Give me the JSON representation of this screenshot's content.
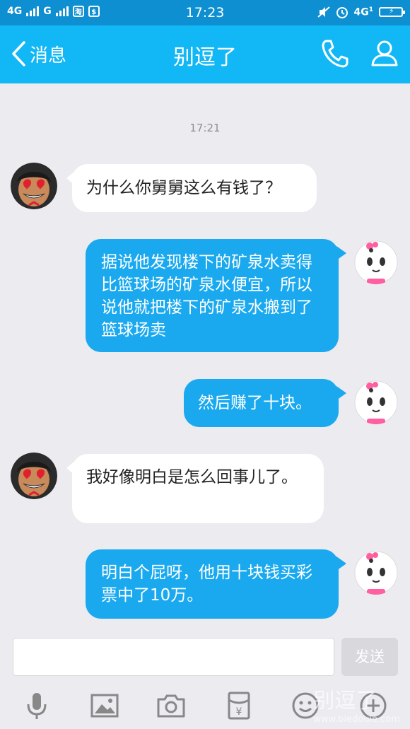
{
  "status_bar": {
    "network_1": "4G",
    "network_2": "G",
    "app_icon_1": "淘",
    "app_icon_2": "$",
    "time": "17:23",
    "network_right": "4G",
    "network_right_sub": "1",
    "battery_glyph": "⚡"
  },
  "nav": {
    "back_label": "消息",
    "title": "别逗了",
    "icons": [
      "phone-icon",
      "profile-icon"
    ]
  },
  "chat": {
    "timestamp": "17:21",
    "messages": [
      {
        "direction": "in",
        "text": "为什么你舅舅这么有钱了？"
      },
      {
        "direction": "out",
        "text": "据说他发现楼下的矿泉水卖得比篮球场的矿泉水便宜，所以说他就把楼下的矿泉水搬到了篮球场卖"
      },
      {
        "direction": "out",
        "text": "然后赚了十块。"
      },
      {
        "direction": "in",
        "text": "我好像明白是怎么回事儿了。"
      },
      {
        "direction": "out",
        "text": "明白个屁呀，他用十块钱买彩票中了10万。"
      }
    ]
  },
  "composer": {
    "input_value": "",
    "input_placeholder": "",
    "send_label": "发送",
    "tools": [
      "microphone-icon",
      "image-icon",
      "camera-icon",
      "red-packet-icon",
      "emoji-icon",
      "plus-icon"
    ]
  },
  "watermark": {
    "title": "别逗了",
    "url": "www.biedoule.com"
  },
  "colors": {
    "nav_bg": "#12b7f5",
    "status_bg": "#0e8fd2",
    "out_bubble": "#1aa9ef",
    "in_bubble": "#ffffff",
    "background": "#ebebf0"
  }
}
